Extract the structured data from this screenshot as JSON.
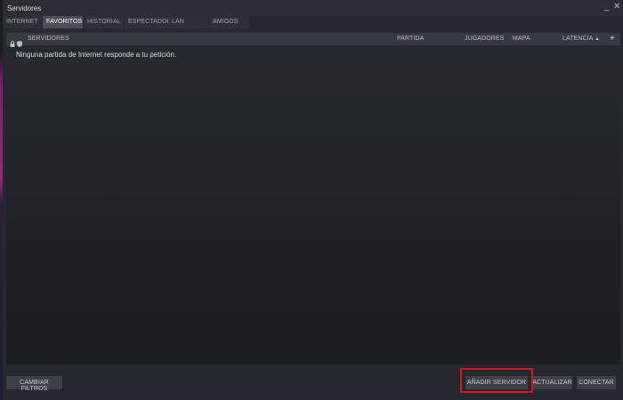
{
  "window": {
    "title": "Servidores",
    "minimize_glyph": "_",
    "close_glyph": "✕"
  },
  "tabs": [
    {
      "label": "INTERNET",
      "active": false
    },
    {
      "label": "FAVORITOS",
      "active": true
    },
    {
      "label": "HISTORIAL",
      "active": false
    },
    {
      "label": "ESPECTADOR",
      "active": false
    },
    {
      "label": "LAN",
      "active": false
    },
    {
      "label": "AMIGOS",
      "active": false
    }
  ],
  "list": {
    "columns": {
      "servers": "SERVIDORES",
      "game": "PARTIDA",
      "players": "JUGADORES",
      "map": "MAPA",
      "latency": "LATENCIA"
    },
    "sort_indicator": "▲",
    "add_column_glyph": "+",
    "icons": [
      "lock-icon",
      "shield-icon"
    ],
    "empty_message": "Ninguna partida de Internet responde a tu petición."
  },
  "buttons": {
    "change_filters": "CAMBIAR FILTROS",
    "add_server": "AÑADIR SERVIDOR",
    "refresh": "ACTUALIZAR",
    "connect": "CONECTAR"
  },
  "colors": {
    "highlight": "#e0121e",
    "accent_edge": "#9a2b7f"
  }
}
